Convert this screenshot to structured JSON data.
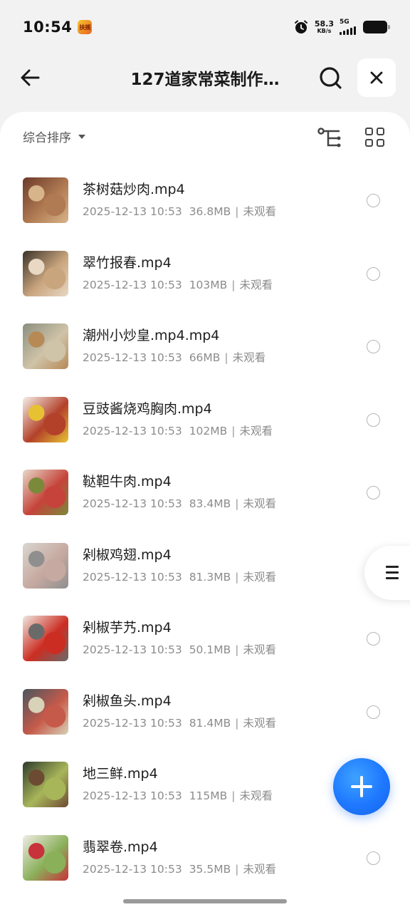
{
  "status_bar": {
    "time": "10:54",
    "app_badge": "扶摇",
    "net_speed_value": "58.3",
    "net_speed_unit": "KB/s",
    "network_type": "5G",
    "alarm_icon": "alarm-clock-icon",
    "battery_icon": "battery-icon"
  },
  "header": {
    "title": "127道家常菜制作…",
    "back_icon": "arrow-left-icon",
    "search_icon": "search-icon",
    "close_icon": "close-icon"
  },
  "toolbar": {
    "sort_label": "综合排序",
    "sort_icon": "caret-down-icon",
    "tree_icon": "tree-view-icon",
    "grid_icon": "grid-view-icon"
  },
  "files": [
    {
      "name": "茶树菇炒肉.mp4",
      "date": "2025-12-13 10:53",
      "size": "36.8MB",
      "status": "未观看",
      "thumb_colors": [
        "#6b3a2a",
        "#b07a52",
        "#d8b48a"
      ]
    },
    {
      "name": "翠竹报春.mp4",
      "date": "2025-12-13 10:53",
      "size": "103MB",
      "status": "未观看",
      "thumb_colors": [
        "#3a3228",
        "#c9a57e",
        "#e8d8c4"
      ]
    },
    {
      "name": "潮州小炒皇.mp4.mp4",
      "date": "2025-12-13 10:53",
      "size": "66MB",
      "status": "未观看",
      "thumb_colors": [
        "#8a8f7e",
        "#cfc3a8",
        "#b78955"
      ]
    },
    {
      "name": "豆豉酱烧鸡胸肉.mp4",
      "date": "2025-12-13 10:53",
      "size": "102MB",
      "status": "未观看",
      "thumb_colors": [
        "#f4efe6",
        "#b3412a",
        "#e6c232"
      ]
    },
    {
      "name": "鞑靼牛肉.mp4",
      "date": "2025-12-13 10:53",
      "size": "83.4MB",
      "status": "未观看",
      "thumb_colors": [
        "#e7d9c9",
        "#c5433a",
        "#7a8a3a"
      ]
    },
    {
      "name": "剁椒鸡翅.mp4",
      "date": "2025-12-13 10:53",
      "size": "81.3MB",
      "status": "未观看",
      "thumb_colors": [
        "#d9d6d0",
        "#c6a9a0",
        "#8f8f8f"
      ]
    },
    {
      "name": "剁椒芋艿.mp4",
      "date": "2025-12-13 10:53",
      "size": "50.1MB",
      "status": "未观看",
      "thumb_colors": [
        "#eee8e0",
        "#cc2d22",
        "#6a6a6a"
      ]
    },
    {
      "name": "剁椒鱼头.mp4",
      "date": "2025-12-13 10:53",
      "size": "81.4MB",
      "status": "未观看",
      "thumb_colors": [
        "#4a5660",
        "#c65a4a",
        "#d7d2b8"
      ]
    },
    {
      "name": "地三鲜.mp4",
      "date": "2025-12-13 10:53",
      "size": "115MB",
      "status": "未观看",
      "thumb_colors": [
        "#2f3b2a",
        "#a8b65a",
        "#6d4a32"
      ]
    },
    {
      "name": "翡翠卷.mp4",
      "date": "2025-12-13 10:53",
      "size": "35.5MB",
      "status": "未观看",
      "thumb_colors": [
        "#f0ece6",
        "#8ab05a",
        "#c8323a"
      ]
    }
  ],
  "floating": {
    "side_menu_icon": "menu-icon",
    "fab_icon": "plus-icon"
  }
}
